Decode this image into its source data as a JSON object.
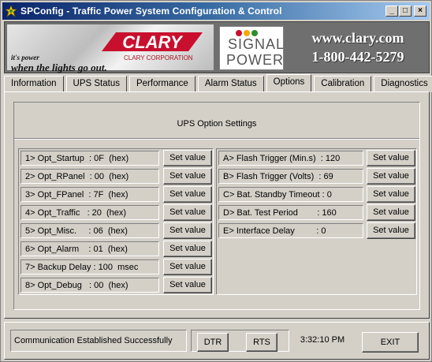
{
  "window": {
    "title": "SPConfig - Traffic Power System Configuration & Control",
    "controls": {
      "minimize": "_",
      "maximize": "□",
      "close": "×"
    }
  },
  "banner": {
    "tagline_line1": "it's power",
    "tagline_line2": "when the lights go out.",
    "clary_logo": "CLARY",
    "clary_corp": "CLARY CORPORATION",
    "signal_line1": "SIGNAL",
    "signal_line2": "POWER",
    "website": "www.clary.com",
    "phone": "1-800-442-5279",
    "brand_red": "#c8102e"
  },
  "tabs": [
    {
      "label": "Information",
      "active": false
    },
    {
      "label": "UPS Status",
      "active": false
    },
    {
      "label": "Performance",
      "active": false
    },
    {
      "label": "Alarm Status",
      "active": false
    },
    {
      "label": "Options",
      "active": true
    },
    {
      "label": "Calibration",
      "active": false
    },
    {
      "label": "Diagnostics",
      "active": false
    }
  ],
  "options": {
    "section_title": "UPS Option Settings",
    "set_label": "Set value",
    "left": [
      {
        "label": "1> Opt_Startup  : 0F  (hex)"
      },
      {
        "label": "2> Opt_RPanel  : 00  (hex)"
      },
      {
        "label": "3> Opt_FPanel  : 7F  (hex)"
      },
      {
        "label": "4> Opt_Traffic   : 20  (hex)"
      },
      {
        "label": "5> Opt_Misc.     : 06  (hex)"
      },
      {
        "label": "6> Opt_Alarm    : 01  (hex)"
      },
      {
        "label": "7> Backup Delay : 100  msec"
      },
      {
        "label": "8> Opt_Debug   : 00  (hex)"
      }
    ],
    "right": [
      {
        "label": "A> Flash Trigger (Min.s)  : 120"
      },
      {
        "label": "B> Flash Trigger (Volts)  : 69"
      },
      {
        "label": "C> Bat. Standby Timeout : 0"
      },
      {
        "label": "D> Bat. Test Period        : 160"
      },
      {
        "label": "E> Interface Delay         : 0"
      }
    ]
  },
  "status": {
    "message": "Communication Established Successfully",
    "dtr_label": "DTR",
    "rts_label": "RTS",
    "time": "3:32:10 PM",
    "exit_label": "EXIT"
  }
}
